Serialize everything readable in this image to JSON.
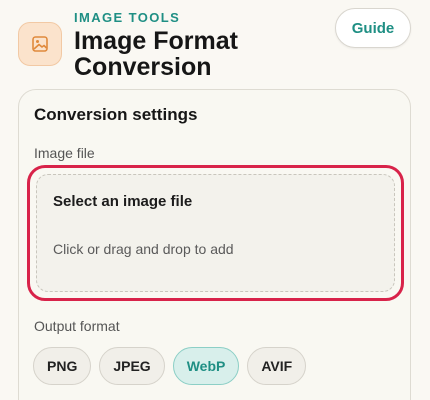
{
  "header": {
    "eyebrow": "IMAGE TOOLS",
    "title": "Image Format Conversion",
    "guide_label": "Guide",
    "app_icon": "image-icon"
  },
  "settings": {
    "title": "Conversion settings",
    "image_file_label": "Image file",
    "dropzone": {
      "title": "Select an image file",
      "hint": "Click or drag and drop to add"
    },
    "output_format_label": "Output format",
    "formats": [
      "PNG",
      "JPEG",
      "WebP",
      "AVIF"
    ],
    "selected_format": "WebP"
  },
  "colors": {
    "accent": "#1f8f84",
    "focus_outline": "#d8234a",
    "icon_bg": "#fbe3cc"
  }
}
